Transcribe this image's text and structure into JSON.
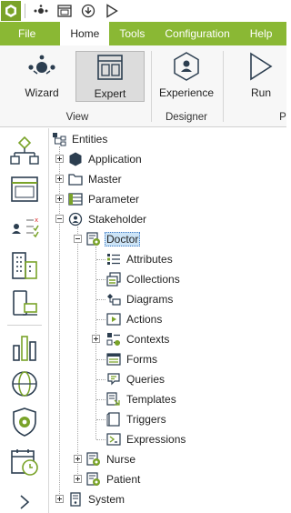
{
  "menu": {
    "items": [
      {
        "label": "File",
        "active": false
      },
      {
        "label": "Home",
        "active": true
      },
      {
        "label": "Tools",
        "active": false
      },
      {
        "label": "Configuration",
        "active": false
      },
      {
        "label": "Help",
        "active": false
      }
    ]
  },
  "ribbon": {
    "wizard_label": "Wizard",
    "expert_label": "Expert",
    "experience_label": "Experience",
    "run_label": "Run",
    "group_view": "View",
    "group_designer": "Designer",
    "group_partial": "P"
  },
  "tree": {
    "root": "Entities",
    "application": "Application",
    "master": "Master",
    "parameter": "Parameter",
    "stakeholder": "Stakeholder",
    "doctor": "Doctor",
    "attributes": "Attributes",
    "collections": "Collections",
    "diagrams": "Diagrams",
    "actions": "Actions",
    "contexts": "Contexts",
    "forms": "Forms",
    "queries": "Queries",
    "templates": "Templates",
    "triggers": "Triggers",
    "expressions": "Expressions",
    "nurse": "Nurse",
    "patient": "Patient",
    "system": "System"
  },
  "colors": {
    "accent_green": "#8ab834",
    "selection_blue": "#cce4f7",
    "icon_teal": "#2f8a8a"
  }
}
